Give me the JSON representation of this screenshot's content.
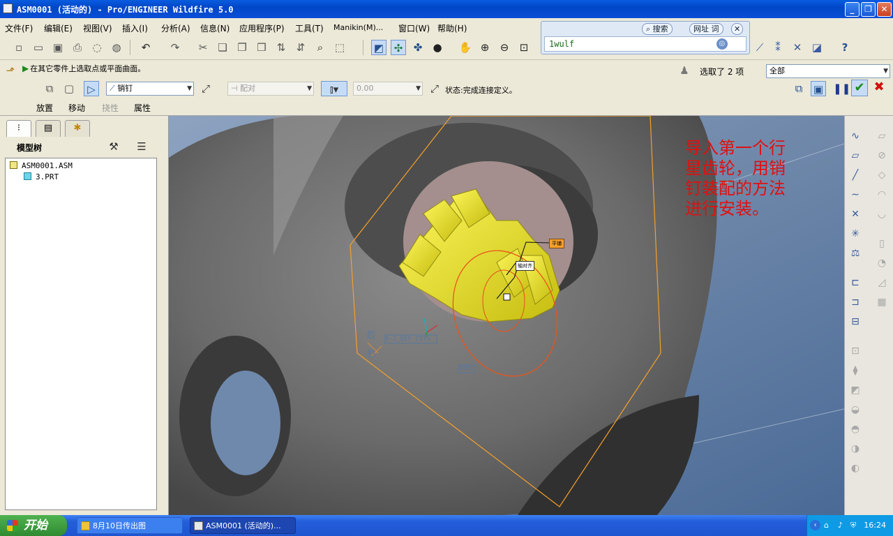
{
  "window": {
    "title": "ASM0001 (活动的) - Pro/ENGINEER Wildfire 5.0",
    "minimize_label": "_",
    "maximize_label": "❐",
    "close_label": "✕"
  },
  "menu": [
    "文件(F)",
    "编辑(E)",
    "视图(V)",
    "插入(I)",
    "分析(A)",
    "信息(N)",
    "应用程序(P)",
    "工具(T)",
    "Manikin(M)...",
    "窗口(W)",
    "帮助(H)"
  ],
  "search_popup": {
    "search_tab": "搜索",
    "url_tab": "网址",
    "word_tab": "词",
    "input_value": "1wulf"
  },
  "dashboard": {
    "prompt": "在其它零件上选取点或平面曲面。",
    "selection_status": "选取了 2 项",
    "filter_value": "全部",
    "constraint_set": "销钉",
    "constraint_type": "配对",
    "offset_value": "0.00",
    "status": "状态:完成连接定义。",
    "tabs": [
      "放置",
      "移动",
      "挠性",
      "属性"
    ]
  },
  "left_panel": {
    "title": "模型树",
    "tree": [
      {
        "label": "ASM0001.ASM",
        "type": "asm"
      },
      {
        "label": "3.PRT",
        "type": "prt"
      }
    ]
  },
  "viewport": {
    "annotation_lines": [
      "导入第一个行",
      "星齿轮，用销",
      "钉装配的方法",
      "进行安装。"
    ],
    "csys_label": "A-2_DEF_CSYS",
    "dtm_label": "DTM1",
    "axis_x_label": "X",
    "axis_y_label": "Y",
    "tag_axis": "平铺",
    "tag_align": "轴对齐",
    "colors": {
      "gear": "#e7e01f",
      "body": "#6a6a6a",
      "datum_plane": "#f5a02a",
      "pin_circle": "#e8551a",
      "annotation": "#e01010"
    }
  },
  "taskbar": {
    "start_label": "开始",
    "task1": "8月10日传出图",
    "task2": "ASM0001 (活动的)...",
    "clock": "16:24"
  }
}
